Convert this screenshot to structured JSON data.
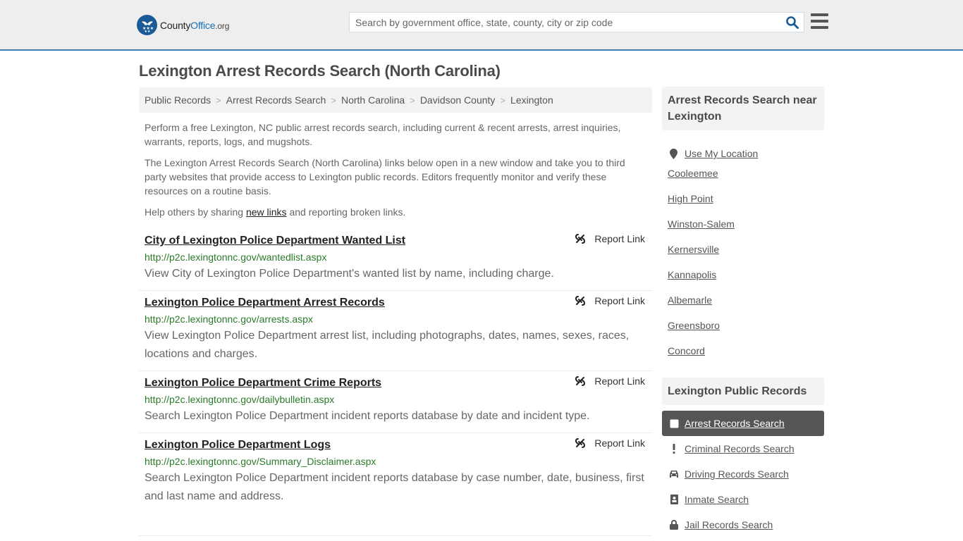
{
  "header": {
    "logo": {
      "county": "County",
      "office": "Office",
      "org": ".org"
    },
    "search": {
      "placeholder": "Search by government office, state, county, city or zip code",
      "value": ""
    },
    "colors": {
      "brand": "#1a5a96",
      "accent_border": "#3c7fb5"
    }
  },
  "main": {
    "title": "Lexington Arrest Records Search (North Carolina)",
    "breadcrumb": [
      "Public Records",
      "Arrest Records Search",
      "North Carolina",
      "Davidson County",
      "Lexington"
    ],
    "intro": {
      "p1": "Perform a free Lexington, NC public arrest records search, including current & recent arrests, arrest inquiries, warrants, reports, logs, and mugshots.",
      "p2": "The Lexington Arrest Records Search (North Carolina) links below open in a new window and take you to third party websites that provide access to Lexington public records. Editors frequently monitor and verify these resources on a routine basis.",
      "p3_before": "Help others by sharing ",
      "p3_link": "new links",
      "p3_after": " and reporting broken links."
    },
    "report_label": "Report Link",
    "links": [
      {
        "title": "City of Lexington Police Department Wanted List",
        "url": "http://p2c.lexingtonnc.gov/wantedlist.aspx",
        "desc": "View City of Lexington Police Department's wanted list by name, including charge."
      },
      {
        "title": "Lexington Police Department Arrest Records",
        "url": "http://p2c.lexingtonnc.gov/arrests.aspx",
        "desc": "View Lexington Police Department arrest list, including photographs, dates, names, sexes, races, locations and charges."
      },
      {
        "title": "Lexington Police Department Crime Reports",
        "url": "http://p2c.lexingtonnc.gov/dailybulletin.aspx",
        "desc": "Search Lexington Police Department incident reports database by date and incident type."
      },
      {
        "title": "Lexington Police Department Logs",
        "url": "http://p2c.lexingtonnc.gov/Summary_Disclaimer.aspx",
        "desc": "Search Lexington Police Department incident reports database by case number, date, business, first and last name and address."
      }
    ]
  },
  "sidebar": {
    "near_heading": "Arrest Records Search near Lexington",
    "use_location": "Use My Location",
    "near_places": [
      "Cooleemee",
      "High Point",
      "Winston-Salem",
      "Kernersville",
      "Kannapolis",
      "Albemarle",
      "Greensboro",
      "Concord"
    ],
    "records_heading": "Lexington Public Records",
    "records": [
      {
        "label": "Arrest Records Search",
        "icon": "square-icon",
        "active": true
      },
      {
        "label": "Criminal Records Search",
        "icon": "exclamation-icon",
        "active": false
      },
      {
        "label": "Driving Records Search",
        "icon": "car-icon",
        "active": false
      },
      {
        "label": "Inmate Search",
        "icon": "id-badge-icon",
        "active": false
      },
      {
        "label": "Jail Records Search",
        "icon": "lock-icon",
        "active": false
      }
    ]
  }
}
